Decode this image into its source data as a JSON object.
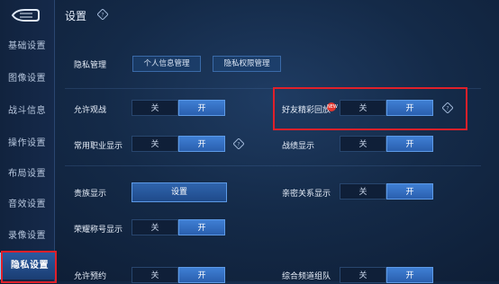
{
  "page": {
    "title": "设置"
  },
  "sidebar": {
    "items": [
      {
        "label": "基础设置"
      },
      {
        "label": "图像设置"
      },
      {
        "label": "战斗信息"
      },
      {
        "label": "操作设置"
      },
      {
        "label": "布局设置"
      },
      {
        "label": "音效设置"
      },
      {
        "label": "录像设置"
      },
      {
        "label": "隐私设置",
        "active": true
      }
    ]
  },
  "privacy": {
    "label": "隐私管理",
    "btn_personal": "个人信息管理",
    "btn_permission": "隐私权限管理"
  },
  "toggle_text": {
    "off": "关",
    "on": "开"
  },
  "settings": {
    "allow_spectate": "允许观战",
    "friend_highlight": "好友精彩回放",
    "common_job": "常用职业显示",
    "battle_show": "战绩显示",
    "noble_show": "贵族显示",
    "noble_button": "设置",
    "intimate_show": "亲密关系显示",
    "glory_title": "荣耀称号显示",
    "row_cut_left": "允许预约",
    "row_cut_right": "综合频道组队"
  },
  "colors": {
    "highlight_box": "#e0202a",
    "toggle_on": "#3f7fd4",
    "badge": "#e2372f"
  }
}
